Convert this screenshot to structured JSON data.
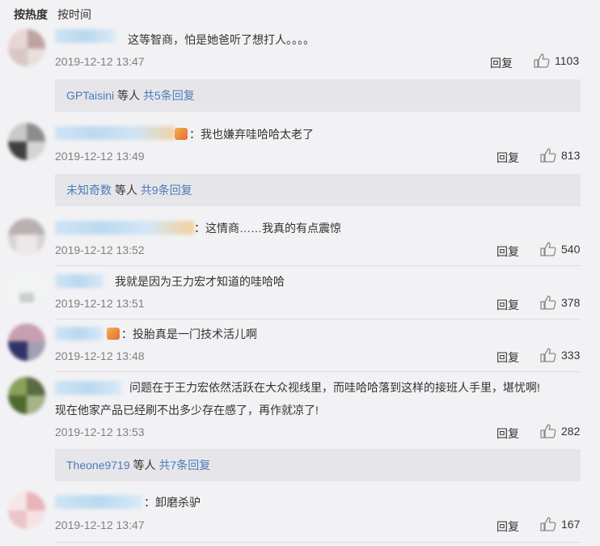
{
  "tabs": [
    {
      "label": "按热度",
      "active": true
    },
    {
      "label": "按时间",
      "active": false
    }
  ],
  "reply_label": "回复",
  "comments": [
    {
      "text": "这等智商，怕是她爸听了想打人。。。。",
      "time": "2019-12-12 13:47",
      "likes": "1103",
      "sub": {
        "user": "GPTaisini",
        "etc": " 等人 ",
        "count": "共5条回复"
      }
    },
    {
      "text": "：我也嫌弃哇哈哈太老了",
      "time": "2019-12-12 13:49",
      "likes": "813",
      "sub": {
        "user": "未知奇数",
        "etc": " 等人 ",
        "count": "共9条回复"
      }
    },
    {
      "text": "：这情商……我真的有点震惊",
      "time": "2019-12-12 13:52",
      "likes": "540"
    },
    {
      "text": "我就是因为王力宏才知道的哇哈哈",
      "time": "2019-12-12 13:51",
      "likes": "378"
    },
    {
      "text": "：投胎真是一门技术活儿啊",
      "time": "2019-12-12 13:48",
      "likes": "333"
    },
    {
      "text": "问题在于王力宏依然活跃在大众视线里，而哇哈哈落到这样的接班人手里，堪忧啊!",
      "text2": "现在他家产品已经刷不出多少存在感了，再作就凉了!",
      "time": "2019-12-12 13:53",
      "likes": "282",
      "sub": {
        "user": "Theone9719",
        "etc": " 等人 ",
        "count": "共7条回复"
      }
    },
    {
      "text": "：卸磨杀驴",
      "time": "2019-12-12 13:47",
      "likes": "167"
    }
  ],
  "colors": {
    "link": "#4a7bb8",
    "time": "#808080",
    "background": "#f2f2f5",
    "sub_background": "#e6e6ea"
  }
}
